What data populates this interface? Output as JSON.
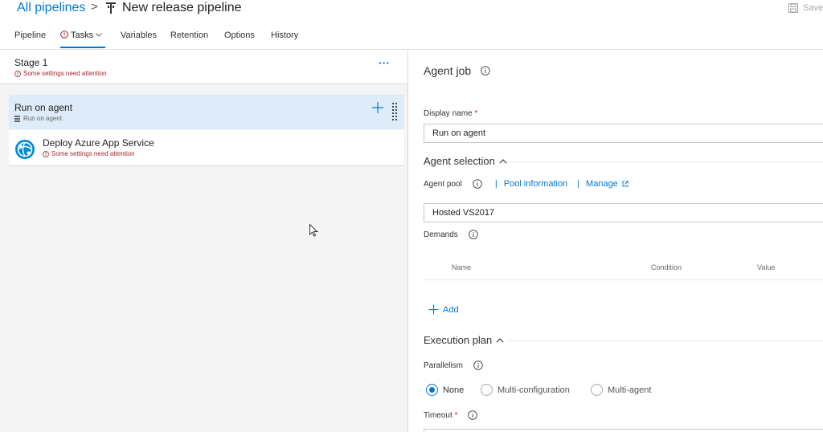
{
  "header": {
    "breadcrumb_link": "All pipelines",
    "breadcrumb_separator": ">",
    "title": "New release pipeline",
    "save_label": "Save"
  },
  "tabs": [
    {
      "label": "Pipeline",
      "active": false
    },
    {
      "label": "Tasks",
      "active": true,
      "warning": true,
      "has_dropdown": true
    },
    {
      "label": "Variables",
      "active": false
    },
    {
      "label": "Retention",
      "active": false
    },
    {
      "label": "Options",
      "active": false
    },
    {
      "label": "History",
      "active": false
    }
  ],
  "left": {
    "stage": {
      "title": "Stage 1",
      "warning": "Some settings need attention",
      "more_label": "···"
    },
    "agent_job": {
      "title": "Run on agent",
      "subtitle": "Run on agent"
    },
    "task": {
      "title": "Deploy Azure App Service",
      "warning": "Some settings need attention",
      "icon": "azure-app-service-icon"
    }
  },
  "right": {
    "heading": "Agent job",
    "display_name": {
      "label": "Display name",
      "required_mark": "*",
      "value": "Run on agent"
    },
    "agent_selection": {
      "title": "Agent selection",
      "agent_pool_label": "Agent pool",
      "pool_separator": "|",
      "pool_info_link": "Pool information",
      "manage_separator": "|",
      "manage_link": "Manage",
      "agent_pool_value": "Hosted VS2017",
      "demands_label": "Demands",
      "columns": [
        "Name",
        "Condition",
        "Value"
      ],
      "add_label": "Add"
    },
    "execution_plan": {
      "title": "Execution plan",
      "parallelism_label": "Parallelism",
      "options": [
        {
          "label": "None",
          "selected": true
        },
        {
          "label": "Multi-configuration",
          "selected": false
        },
        {
          "label": "Multi-agent",
          "selected": false
        }
      ],
      "timeout_label": "Timeout",
      "timeout_required_mark": "*"
    }
  },
  "colors": {
    "accent": "#0078d4",
    "warning": "#a4262c",
    "selected_row": "#deecf9",
    "panel_bg": "#f4f4f4"
  }
}
